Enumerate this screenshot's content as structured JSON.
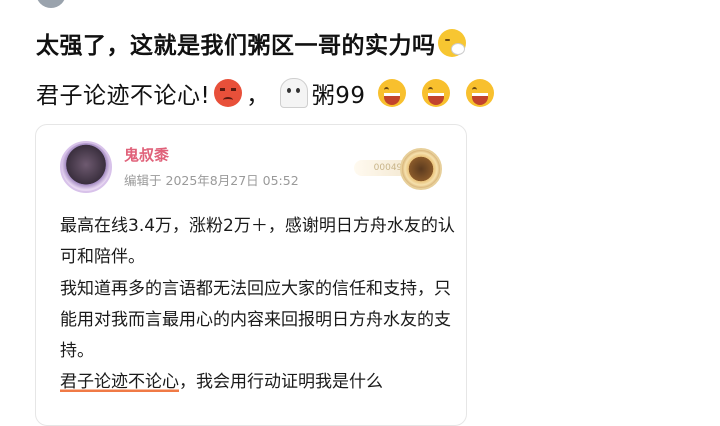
{
  "comment": {
    "line1": "太强了，这就是我们粥区一哥的实力吗",
    "line2_text": "君子论迹不论心!",
    "line2_punct": "，",
    "line2_tag": "粥99"
  },
  "quoted_post": {
    "author": "鬼叔黍",
    "edited_label": "编辑于",
    "date": "2025年8月27日",
    "time": "05:52",
    "badge_text": "000493",
    "body": [
      "最高在线3.4万，涨粉2万＋，感谢明日方舟水友的认可和陪伴。",
      "我知道再多的言语都无法回应大家的信任和支持，只能用对我而言最用心的内容来回报明日方舟水友的支持。"
    ],
    "last_line_highlight": "君子论迹不论心",
    "last_line_rest": "，我会用行动证明我是什么"
  },
  "colors": {
    "author": "#e0627a",
    "highlight_underline": "#f07a46"
  },
  "icons": [
    "sneezing-face-emoji",
    "angry-face-emoji",
    "ghost-emoji",
    "grinning-squint-emoji",
    "medal-icon"
  ]
}
